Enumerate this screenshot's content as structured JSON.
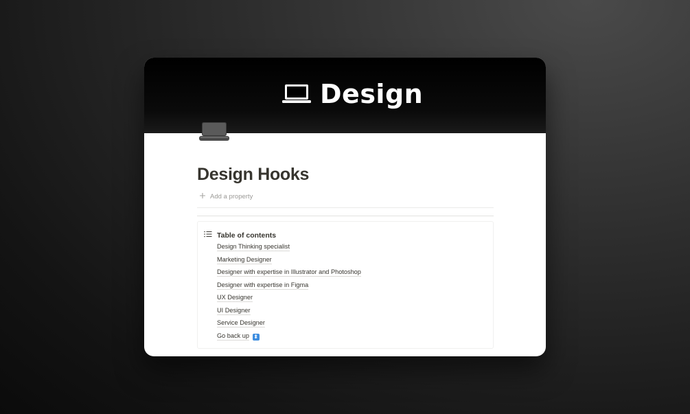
{
  "cover": {
    "title": "Design",
    "icon": "laptop-icon"
  },
  "page": {
    "icon": "laptop-icon",
    "title": "Design Hooks",
    "add_property_label": "Add a property"
  },
  "toc": {
    "title": "Table of contents",
    "icon": "list-icon",
    "items": [
      "Design Thinking specialist",
      "Marketing Designer",
      "Designer with expertise in Illustrator and Photoshop",
      "Designer with expertise in Figma",
      "UX Designer",
      "UI Designer",
      "Service Designer",
      "Go back up"
    ],
    "last_item_emoji": "up-down-arrow-icon",
    "last_item_emoji_glyph": "⬍"
  },
  "colors": {
    "text": "#37352f",
    "muted": "#9b9a97",
    "emoji_blue": "#3f8ee0"
  }
}
